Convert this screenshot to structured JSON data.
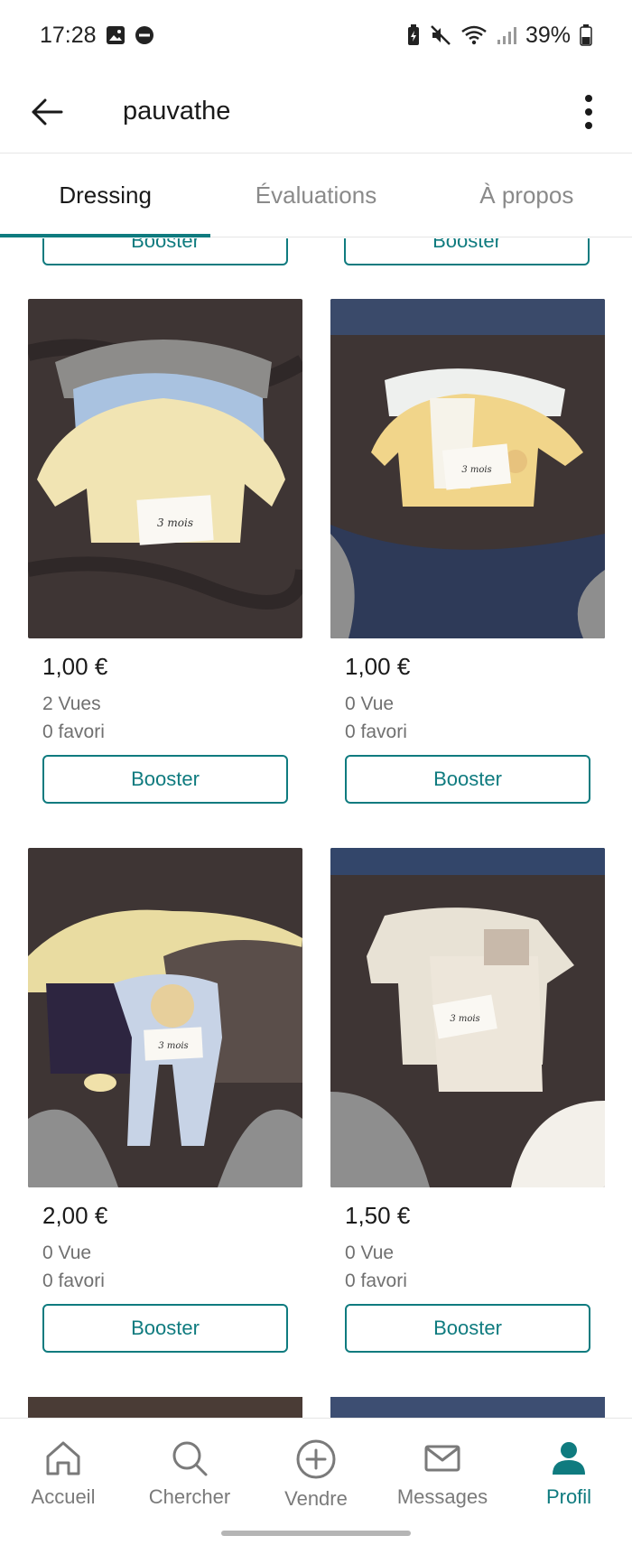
{
  "status_bar": {
    "time": "17:28",
    "battery": "39%"
  },
  "header": {
    "title": "pauvathe"
  },
  "tabs": [
    {
      "label": "Dressing",
      "active": true
    },
    {
      "label": "Évaluations",
      "active": false
    },
    {
      "label": "À propos",
      "active": false
    }
  ],
  "top_row_partial": {
    "left_button": "Booster",
    "right_button": "Booster"
  },
  "items": [
    {
      "price": "1,00 €",
      "views": "2 Vues",
      "favorites": "0 favori",
      "button": "Booster",
      "tag": "3 mois"
    },
    {
      "price": "1,00 €",
      "views": "0 Vue",
      "favorites": "0 favori",
      "button": "Booster",
      "tag": "3 mois"
    },
    {
      "price": "2,00 €",
      "views": "0 Vue",
      "favorites": "0 favori",
      "button": "Booster",
      "tag": "3 mois"
    },
    {
      "price": "1,50 €",
      "views": "0 Vue",
      "favorites": "0 favori",
      "button": "Booster",
      "tag": "3 mois"
    }
  ],
  "bottom_nav": [
    {
      "label": "Accueil",
      "icon": "home-icon",
      "active": false
    },
    {
      "label": "Chercher",
      "icon": "search-icon",
      "active": false
    },
    {
      "label": "Vendre",
      "icon": "plus-circle-icon",
      "active": false
    },
    {
      "label": "Messages",
      "icon": "mail-icon",
      "active": false
    },
    {
      "label": "Profil",
      "icon": "profile-icon",
      "active": true
    }
  ],
  "colors": {
    "accent": "#0f7b7f",
    "muted_text": "#707070",
    "tab_inactive": "#8a8a8a",
    "bedding": "#3e3534"
  }
}
